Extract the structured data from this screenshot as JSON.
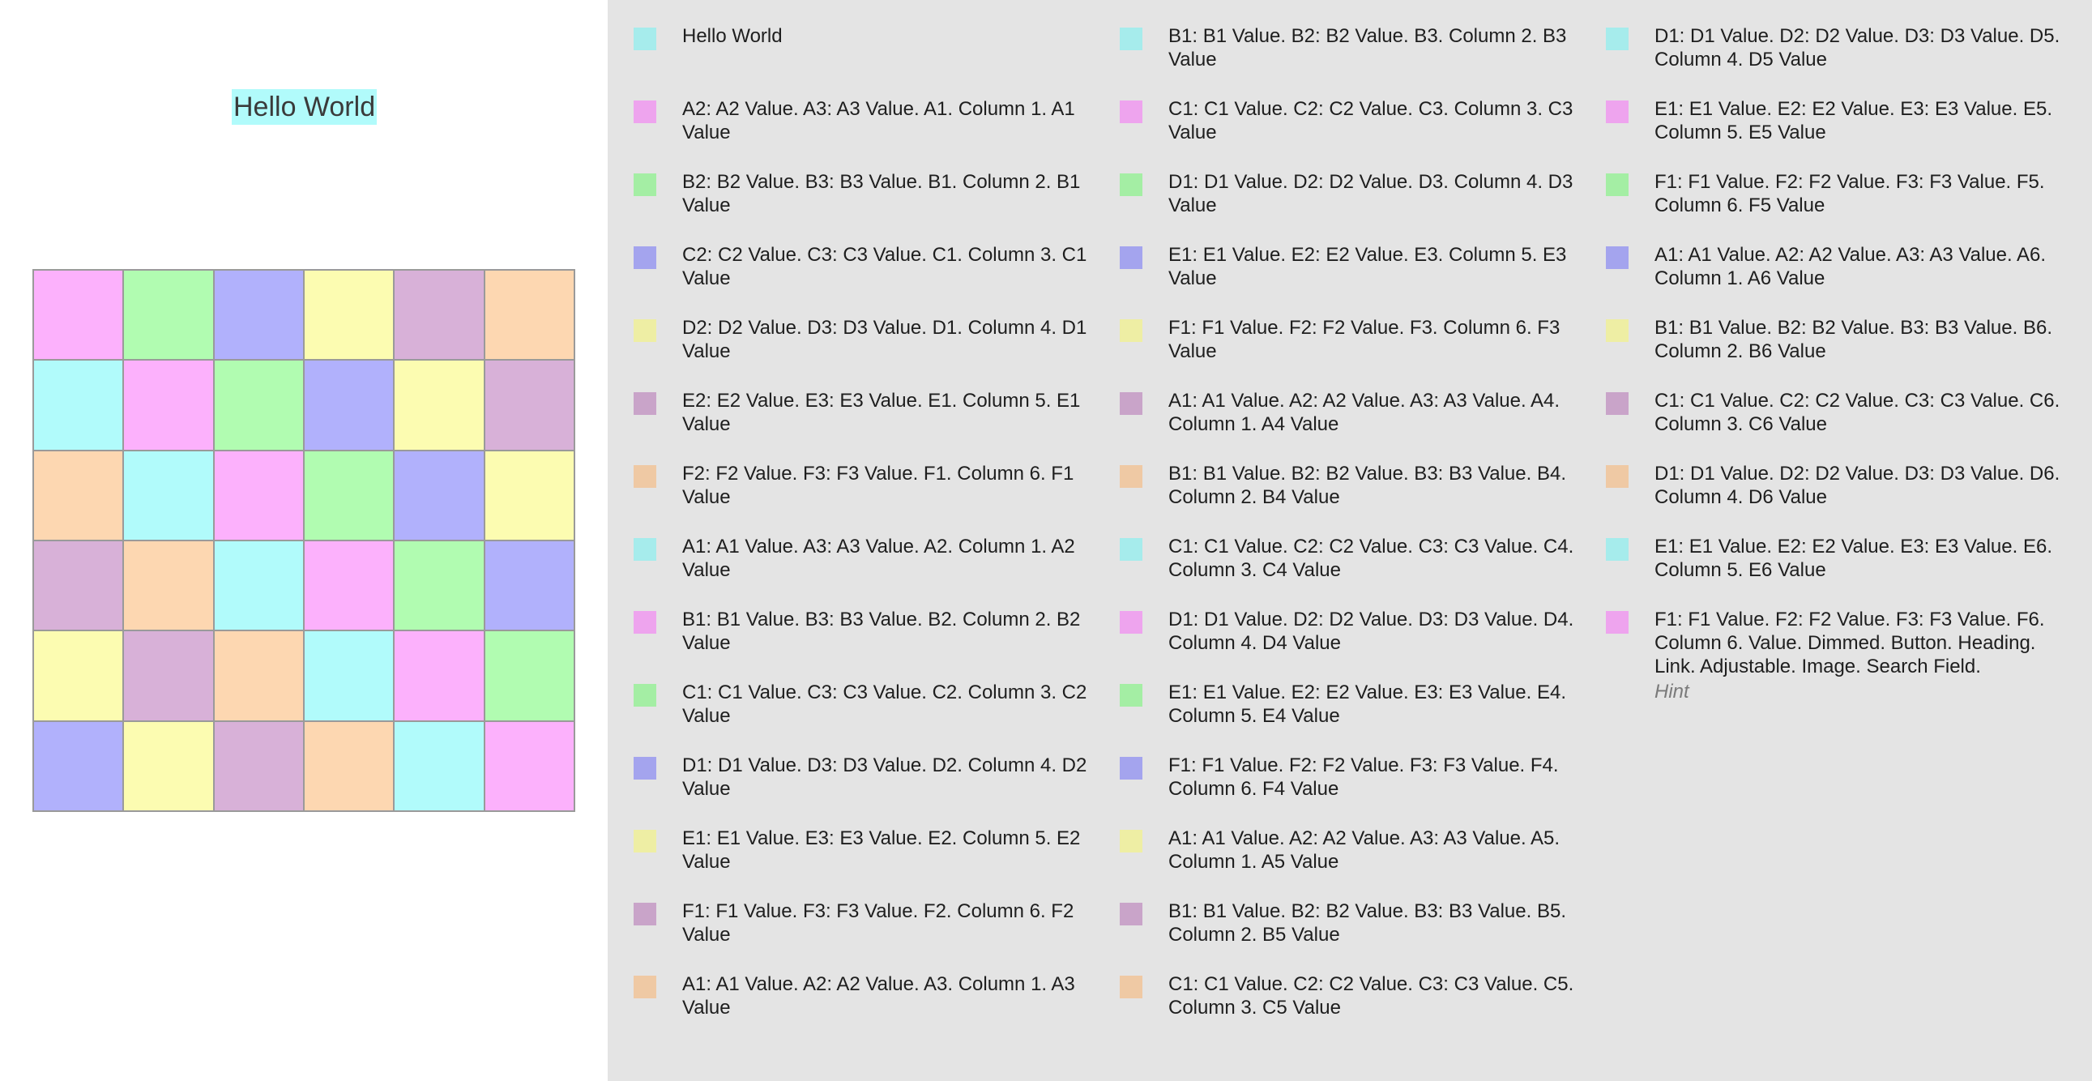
{
  "header": {
    "title": "Hello World"
  },
  "colors": {
    "cyan": "#b1fbfb",
    "pink": "#fcb1fc",
    "green": "#b1fcb1",
    "blue": "#b1b1fc",
    "yellow": "#fcfcb1",
    "purple": "#d8b1d8",
    "orange": "#fdd7b1",
    "sw_cyan": "#a6ecec",
    "sw_pink": "#eea4ee",
    "sw_green": "#a4eea4",
    "sw_blue": "#a4a4ee",
    "sw_yellow": "#eeeea4",
    "sw_purple": "#c9a4c9",
    "sw_orange": "#efc9a4"
  },
  "grid": {
    "rows": [
      [
        "pink",
        "green",
        "blue",
        "yellow",
        "purple",
        "orange"
      ],
      [
        "cyan",
        "pink",
        "green",
        "blue",
        "yellow",
        "purple"
      ],
      [
        "orange",
        "cyan",
        "pink",
        "green",
        "blue",
        "yellow"
      ],
      [
        "purple",
        "orange",
        "cyan",
        "pink",
        "green",
        "blue"
      ],
      [
        "yellow",
        "purple",
        "orange",
        "cyan",
        "pink",
        "green"
      ],
      [
        "blue",
        "yellow",
        "purple",
        "orange",
        "cyan",
        "pink"
      ]
    ]
  },
  "list": {
    "columns": [
      [
        {
          "color": "sw_cyan",
          "text": "Hello World"
        },
        {
          "color": "sw_pink",
          "text": "A2: A2 Value. A3: A3 Value. A1. Column 1. A1 Value"
        },
        {
          "color": "sw_green",
          "text": "B2: B2 Value. B3: B3 Value. B1. Column 2. B1 Value"
        },
        {
          "color": "sw_blue",
          "text": "C2: C2 Value. C3: C3 Value. C1. Column 3. C1 Value"
        },
        {
          "color": "sw_yellow",
          "text": "D2: D2 Value. D3: D3 Value. D1. Column 4. D1 Value"
        },
        {
          "color": "sw_purple",
          "text": "E2: E2 Value. E3: E3 Value. E1. Column 5. E1 Value"
        },
        {
          "color": "sw_orange",
          "text": "F2: F2 Value. F3: F3 Value. F1. Column 6. F1 Value"
        },
        {
          "color": "sw_cyan",
          "text": "A1: A1 Value. A3: A3 Value. A2. Column 1. A2 Value"
        },
        {
          "color": "sw_pink",
          "text": "B1: B1 Value. B3: B3 Value. B2. Column 2. B2 Value"
        },
        {
          "color": "sw_green",
          "text": "C1: C1 Value. C3: C3 Value. C2. Column 3. C2 Value"
        },
        {
          "color": "sw_blue",
          "text": "D1: D1 Value. D3: D3 Value. D2. Column 4. D2 Value"
        },
        {
          "color": "sw_yellow",
          "text": "E1: E1 Value. E3: E3 Value. E2. Column 5. E2 Value"
        },
        {
          "color": "sw_purple",
          "text": "F1: F1 Value. F3: F3 Value. F2. Column 6. F2 Value"
        },
        {
          "color": "sw_orange",
          "text": "A1: A1 Value. A2: A2 Value. A3. Column 1. A3 Value"
        }
      ],
      [
        {
          "color": "sw_cyan",
          "text": "B1: B1 Value. B2: B2 Value. B3. Column 2. B3 Value"
        },
        {
          "color": "sw_pink",
          "text": "C1: C1 Value. C2: C2 Value. C3. Column 3. C3 Value"
        },
        {
          "color": "sw_green",
          "text": "D1: D1 Value. D2: D2 Value. D3. Column 4. D3 Value"
        },
        {
          "color": "sw_blue",
          "text": "E1: E1 Value. E2: E2 Value. E3. Column 5. E3 Value"
        },
        {
          "color": "sw_yellow",
          "text": "F1: F1 Value. F2: F2 Value. F3. Column 6. F3 Value"
        },
        {
          "color": "sw_purple",
          "text": "A1: A1 Value. A2: A2 Value. A3: A3 Value. A4. Column 1. A4 Value"
        },
        {
          "color": "sw_orange",
          "text": "B1: B1 Value. B2: B2 Value. B3: B3 Value. B4. Column 2. B4 Value"
        },
        {
          "color": "sw_cyan",
          "text": "C1: C1 Value. C2: C2 Value. C3: C3 Value. C4. Column 3. C4 Value"
        },
        {
          "color": "sw_pink",
          "text": "D1: D1 Value. D2: D2 Value. D3: D3 Value. D4. Column 4. D4 Value"
        },
        {
          "color": "sw_green",
          "text": "E1: E1 Value. E2: E2 Value. E3: E3 Value. E4. Column 5. E4 Value"
        },
        {
          "color": "sw_blue",
          "text": "F1: F1 Value. F2: F2 Value. F3: F3 Value. F4. Column 6. F4 Value"
        },
        {
          "color": "sw_yellow",
          "text": "A1: A1 Value. A2: A2 Value. A3: A3 Value. A5. Column 1. A5 Value"
        },
        {
          "color": "sw_purple",
          "text": "B1: B1 Value. B2: B2 Value. B3: B3 Value. B5. Column 2. B5 Value"
        },
        {
          "color": "sw_orange",
          "text": "C1: C1 Value. C2: C2 Value. C3: C3 Value. C5. Column 3. C5 Value"
        }
      ],
      [
        {
          "color": "sw_cyan",
          "text": "D1: D1 Value. D2: D2 Value. D3: D3 Value. D5. Column 4. D5 Value"
        },
        {
          "color": "sw_pink",
          "text": "E1: E1 Value. E2: E2 Value. E3: E3 Value. E5. Column 5. E5 Value"
        },
        {
          "color": "sw_green",
          "text": "F1: F1 Value. F2: F2 Value. F3: F3 Value. F5. Column 6. F5 Value"
        },
        {
          "color": "sw_blue",
          "text": "A1: A1 Value. A2: A2 Value. A3: A3 Value. A6. Column 1. A6 Value"
        },
        {
          "color": "sw_yellow",
          "text": "B1: B1 Value. B2: B2 Value. B3: B3 Value. B6. Column 2. B6 Value"
        },
        {
          "color": "sw_purple",
          "text": "C1: C1 Value. C2: C2 Value. C3: C3 Value. C6. Column 3. C6 Value"
        },
        {
          "color": "sw_orange",
          "text": "D1: D1 Value. D2: D2 Value. D3: D3 Value. D6. Column 4. D6 Value"
        },
        {
          "color": "sw_cyan",
          "text": "E1: E1 Value. E2: E2 Value. E3: E3 Value. E6. Column 5. E6 Value"
        },
        {
          "color": "sw_pink",
          "text": "F1: F1 Value. F2: F2 Value. F3: F3 Value. F6. Column 6. Value. Dimmed. Button. Heading. Link. Adjustable. Image. Search Field."
        }
      ]
    ],
    "hint": "Hint"
  }
}
